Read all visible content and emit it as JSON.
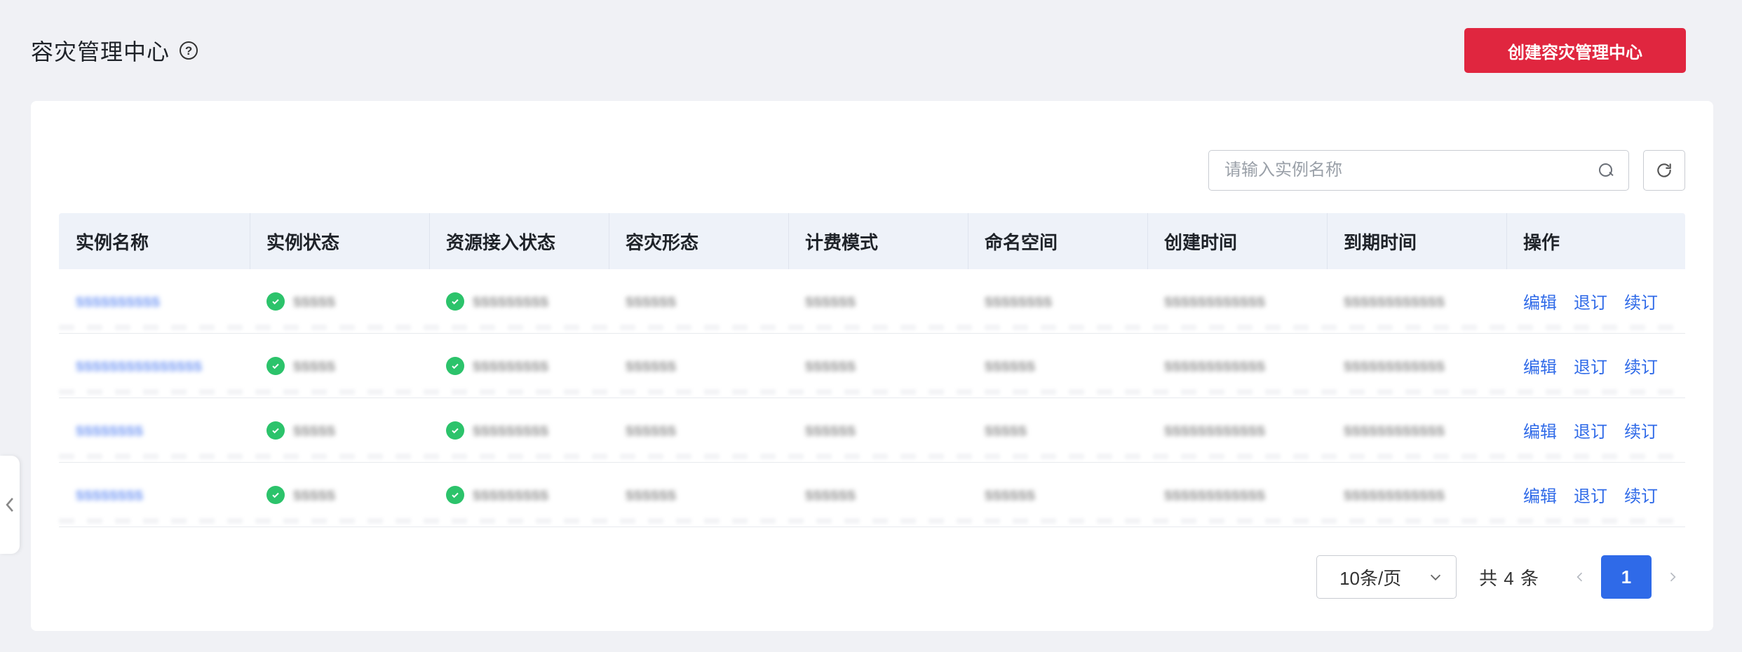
{
  "header": {
    "title": "容灾管理中心",
    "help_icon": "?",
    "create_button": "创建容灾管理中心"
  },
  "toolbar": {
    "search_placeholder": "请输入实例名称",
    "search_value": ""
  },
  "table": {
    "columns": [
      "实例名称",
      "实例状态",
      "资源接入状态",
      "容灾形态",
      "计费模式",
      "命名空间",
      "创建时间",
      "到期时间",
      "操作"
    ],
    "rows": [
      {
        "name": "ssssssssss",
        "status": "sssss",
        "access": "sssssssss",
        "form": "ssssss",
        "billing": "ssssss",
        "namespace": "ssssssss",
        "created": "ssssssssssss",
        "expires": "ssssssssssss"
      },
      {
        "name": "sssssssssssssss",
        "status": "sssss",
        "access": "sssssssss",
        "form": "ssssss",
        "billing": "ssssss",
        "namespace": "ssssss",
        "created": "ssssssssssss",
        "expires": "ssssssssssss"
      },
      {
        "name": "ssssssss",
        "status": "sssss",
        "access": "sssssssss",
        "form": "ssssss",
        "billing": "ssssss",
        "namespace": "sssss",
        "created": "ssssssssssss",
        "expires": "ssssssssssss"
      },
      {
        "name": "ssssssss",
        "status": "sssss",
        "access": "sssssssss",
        "form": "ssssss",
        "billing": "ssssss",
        "namespace": "ssssss",
        "created": "ssssssssssss",
        "expires": "ssssssssssss"
      }
    ],
    "actions": {
      "edit": "编辑",
      "unsubscribe": "退订",
      "renew": "续订"
    }
  },
  "pagination": {
    "page_size": "10条/页",
    "total": "共 4 条",
    "current_page": "1"
  },
  "colors": {
    "primary": "#e0263f",
    "link": "#2f6ae8",
    "success": "#2cc36b"
  }
}
